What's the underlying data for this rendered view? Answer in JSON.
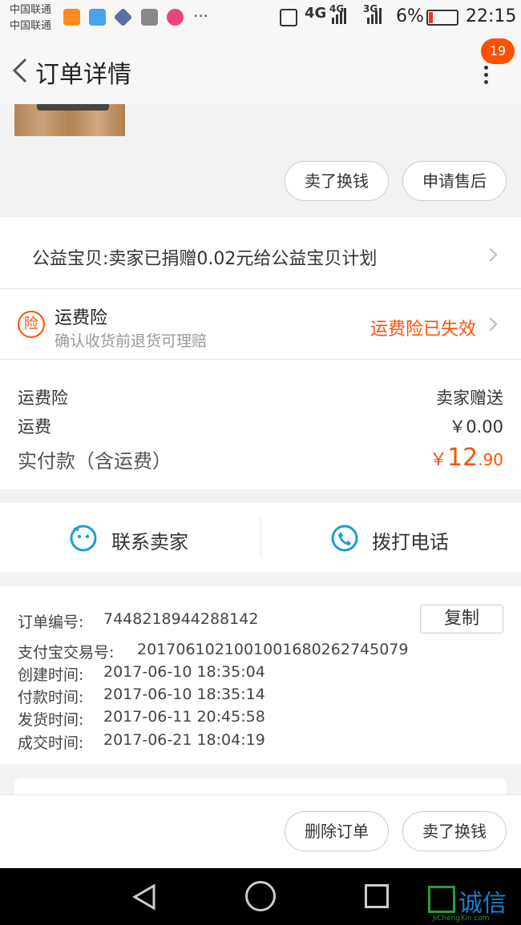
{
  "status_bar": {
    "carrier1": "中国联通",
    "carrier2": "中国联通",
    "network1": "4G",
    "network2": "4G",
    "network3": "3G",
    "battery": "6%",
    "time": "22:15",
    "more": "···"
  },
  "header": {
    "title": "订单详情",
    "badge": "19"
  },
  "actions_top": {
    "sell_label": "卖了换钱",
    "after_sale_label": "申请售后"
  },
  "charity": {
    "text": "公益宝贝:卖家已捐赠0.02元给公益宝贝计划"
  },
  "freight_insurance": {
    "icon_char": "险",
    "title": "运费险",
    "subtitle": "确认收货前退货可理赔",
    "status": "运费险已失效"
  },
  "pricing": {
    "insurance_label": "运费险",
    "insurance_value": "卖家赠送",
    "shipping_label": "运费",
    "shipping_value": "￥0.00",
    "total_label": "实付款（含运费）",
    "total_currency": "￥",
    "total_int": "12",
    "total_dec": ".90"
  },
  "contact": {
    "seller_label": "联系卖家",
    "call_label": "拨打电话"
  },
  "order_info": {
    "copy_label": "复制",
    "order_no_label": "订单编号:",
    "order_no": "7448218944288142",
    "alipay_label": "支付宝交易号:",
    "alipay_no": "2017061021001001680262745079",
    "created_label": "创建时间:",
    "created": "2017-06-10 18:35:04",
    "paid_label": "付款时间:",
    "paid": "2017-06-10 18:35:14",
    "shipped_label": "发货时间:",
    "shipped": "2017-06-11 20:45:58",
    "done_label": "成交时间:",
    "done": "2017-06-21 18:04:19"
  },
  "bottom_actions": {
    "delete_label": "删除订单",
    "sell_label": "卖了换钱"
  },
  "watermark": {
    "brand": "诚信",
    "site": "JiChengXin.com"
  },
  "colors": {
    "accent": "#ff5000",
    "icon_blue": "#1e9bd7"
  }
}
